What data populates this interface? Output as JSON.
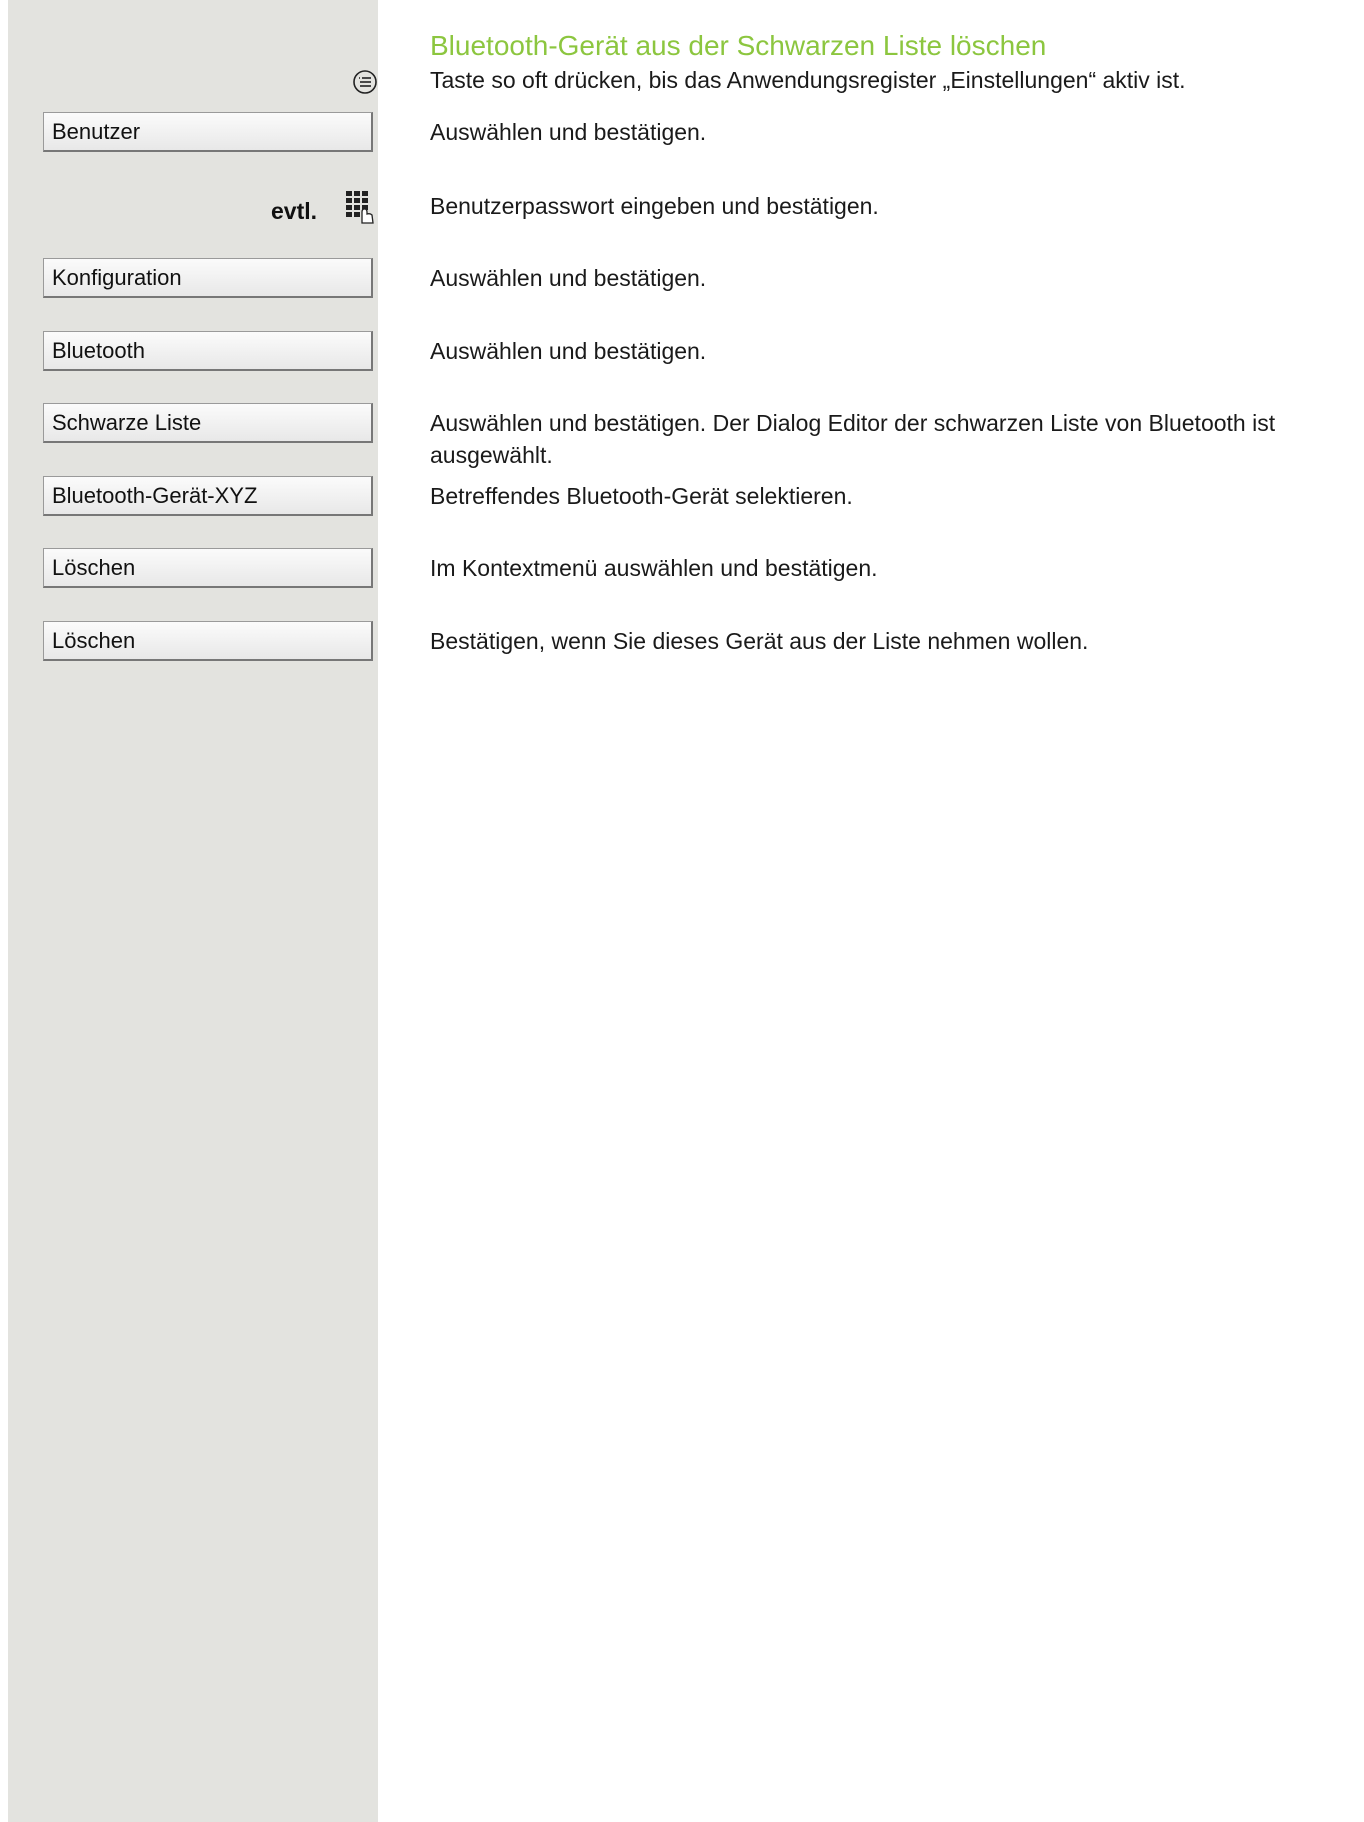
{
  "title": "Bluetooth-Gerät aus der Schwarzen Liste löschen",
  "steps": [
    {
      "icon": "menu-key-icon",
      "text": "Taste so oft drücken, bis das Anwendungsregister „Einstellungen“ aktiv ist."
    },
    {
      "button": "Benutzer",
      "text": "Auswählen und bestätigen."
    },
    {
      "prefix": "evtl.",
      "icon": "keypad-icon",
      "text": "Benutzerpasswort eingeben und bestätigen."
    },
    {
      "button": "Konfiguration",
      "text": "Auswählen und bestätigen."
    },
    {
      "button": "Bluetooth",
      "text": "Auswählen und bestätigen."
    },
    {
      "button": "Schwarze Liste",
      "text": "Auswählen und bestätigen. Der Dialog Editor der schwarzen Liste von Bluetooth ist ausgewählt."
    },
    {
      "button": "Bluetooth-Gerät-XYZ",
      "text": "Betreffendes Bluetooth-Gerät selektieren."
    },
    {
      "button": "Löschen",
      "text": "Im Kontextmenü auswählen und bestätigen."
    },
    {
      "button": "Löschen",
      "text": "Bestätigen, wenn Sie dieses Gerät aus der Liste nehmen wollen."
    }
  ],
  "colors": {
    "title": "#8cc63f",
    "sidebar": "#e3e3df"
  }
}
